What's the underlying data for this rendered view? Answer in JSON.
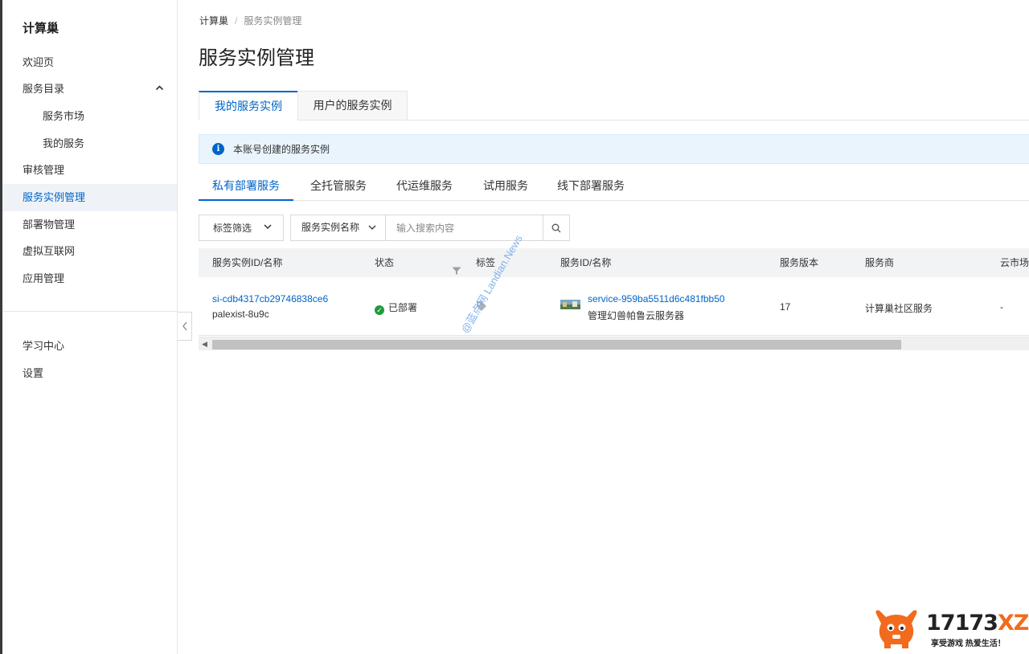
{
  "sidebar": {
    "title": "计算巢",
    "items": [
      {
        "label": "欢迎页"
      },
      {
        "label": "服务目录"
      },
      {
        "label": "服务市场"
      },
      {
        "label": "我的服务"
      },
      {
        "label": "审核管理"
      },
      {
        "label": "服务实例管理"
      },
      {
        "label": "部署物管理"
      },
      {
        "label": "虚拟互联网"
      },
      {
        "label": "应用管理"
      }
    ],
    "bottom_items": [
      {
        "label": "学习中心"
      },
      {
        "label": "设置"
      }
    ]
  },
  "breadcrumb": {
    "root": "计算巢",
    "separator": "/",
    "current": "服务实例管理"
  },
  "page_title": "服务实例管理",
  "main_tabs": [
    {
      "label": "我的服务实例"
    },
    {
      "label": "用户的服务实例"
    }
  ],
  "info_bar": {
    "icon": "info-icon",
    "text": "本账号创建的服务实例"
  },
  "sub_tabs": [
    {
      "label": "私有部署服务"
    },
    {
      "label": "全托管服务"
    },
    {
      "label": "代运维服务"
    },
    {
      "label": "试用服务"
    },
    {
      "label": "线下部署服务"
    }
  ],
  "filter": {
    "tag_filter_label": "标签筛选",
    "search_field_label": "服务实例名称",
    "search_placeholder": "输入搜索内容"
  },
  "table": {
    "headers": {
      "instance": "服务实例ID/名称",
      "status": "状态",
      "tags": "标签",
      "service": "服务ID/名称",
      "version": "服务版本",
      "provider": "服务商",
      "market": "云市场"
    },
    "rows": [
      {
        "instance_id": "si-cdb4317cb29746838ce6",
        "instance_name": "palexist-8u9c",
        "status": "已部署",
        "service_id": "service-959ba5511d6c481fbb50",
        "service_name": "管理幻兽帕鲁云服务器",
        "version": "17",
        "provider": "计算巢社区服务",
        "market": "-"
      }
    ]
  },
  "watermark": "@蓝点网 Landian.News",
  "logo": {
    "brand_number": "17173",
    "brand_suffix": "XZ",
    "slogan": "享受游戏 热爱生活！"
  },
  "colors": {
    "accent": "#0064c8",
    "success": "#1f9b3a",
    "info_bg": "#e9f4fd",
    "logo_orange": "#f26b1d"
  }
}
